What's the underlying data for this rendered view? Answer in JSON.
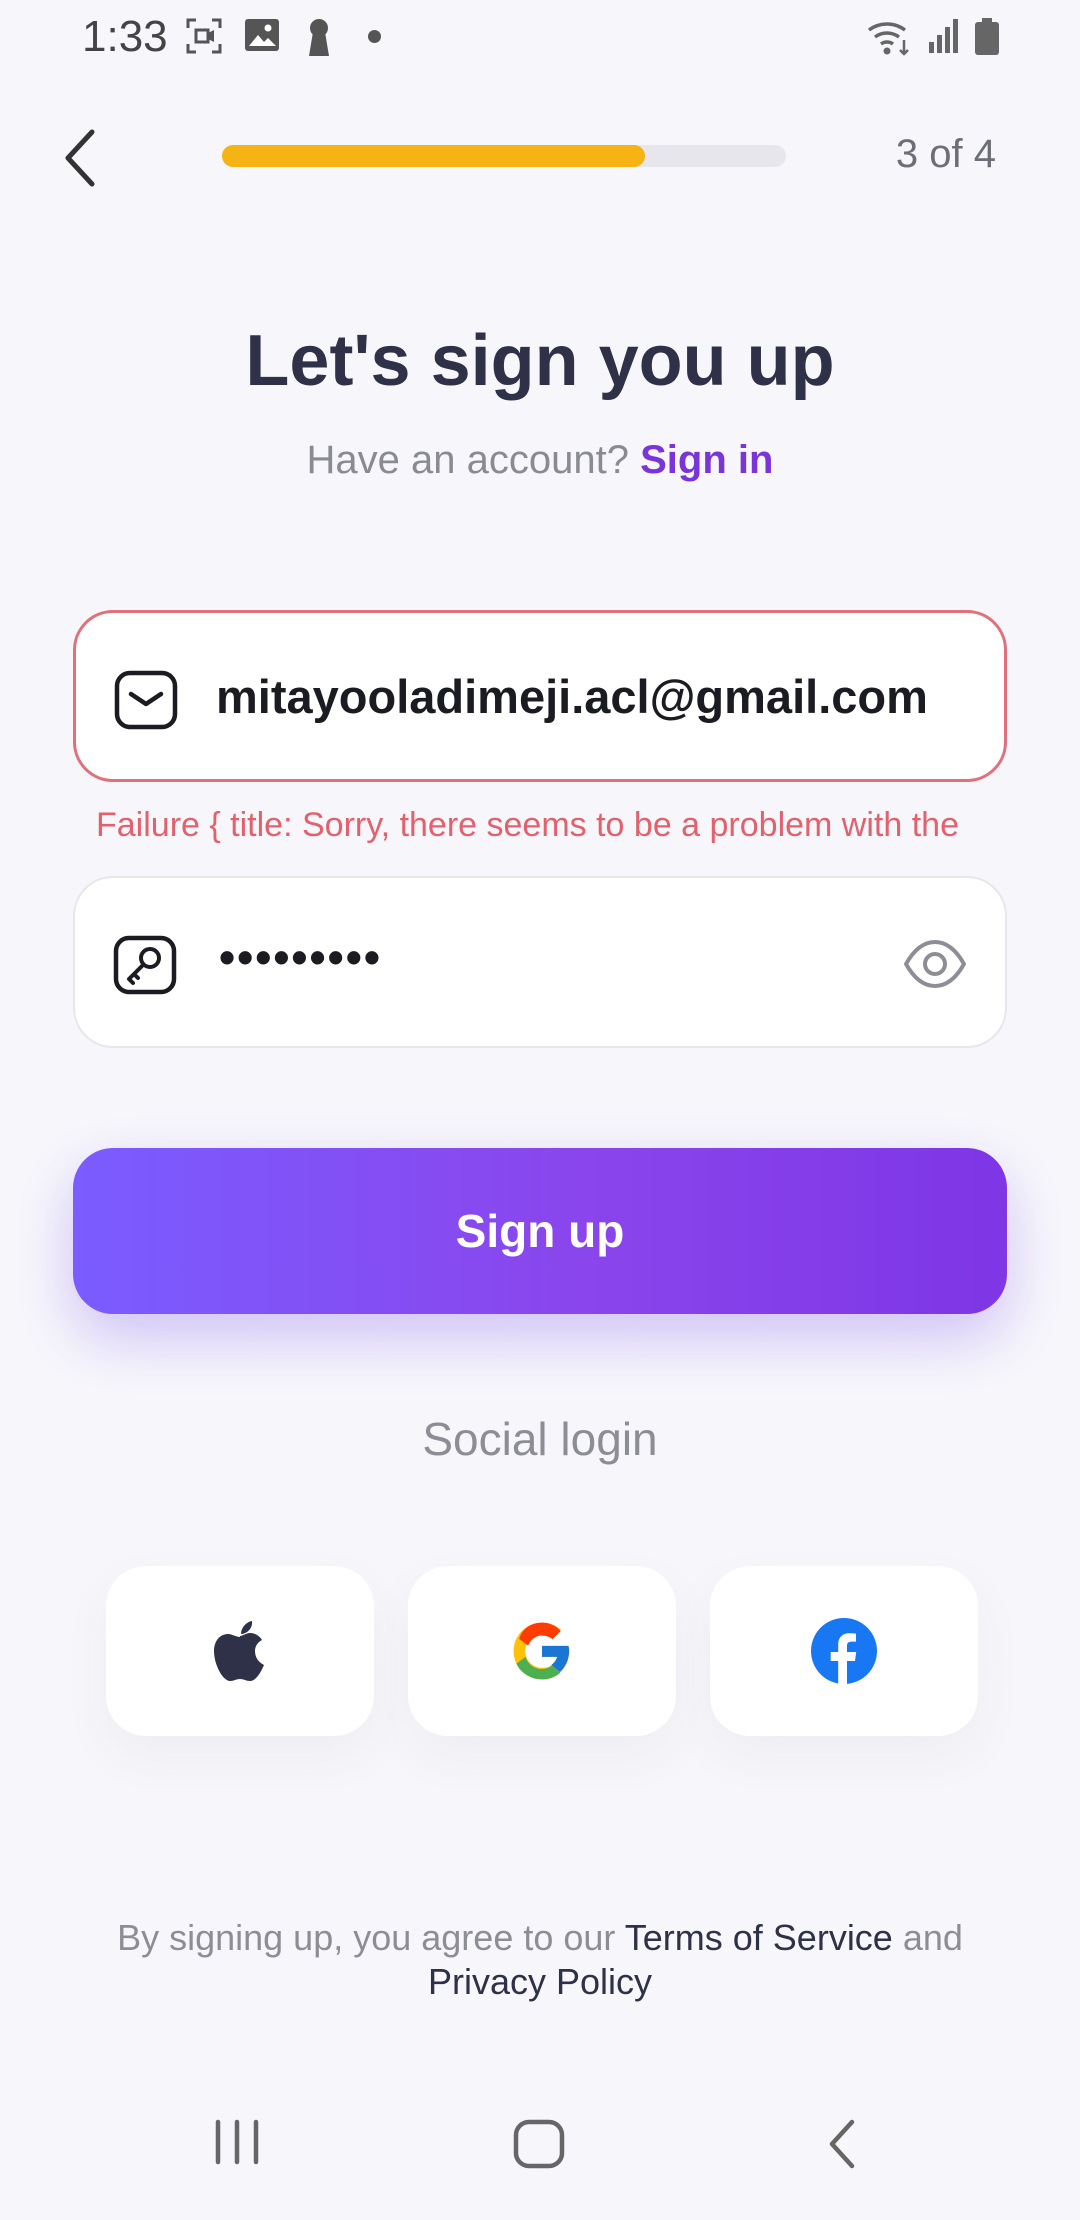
{
  "status_bar": {
    "time": "1:33",
    "left_icons": [
      "screen-record-icon",
      "gallery-icon",
      "keyhole-icon",
      "dot-icon"
    ],
    "right_icons": [
      "wifi-icon",
      "signal-icon",
      "battery-icon"
    ]
  },
  "header": {
    "back_icon": "chevron-left-icon",
    "progress_fraction": 0.75,
    "step_text": "3 of 4"
  },
  "title": "Let's sign you up",
  "subtitle": {
    "prompt": "Have an account? ",
    "link": "Sign in"
  },
  "email": {
    "icon": "mail-icon",
    "value": "mitayooladimeji.acl@gmail.com",
    "error": "Failure { title: Sorry, there seems to be a problem with the"
  },
  "password": {
    "icon": "key-icon",
    "value": "•••••••••",
    "toggle_icon": "eye-icon"
  },
  "signup_button": "Sign up",
  "social": {
    "label": "Social login",
    "buttons": [
      "apple-icon",
      "google-icon",
      "facebook-icon"
    ]
  },
  "terms": {
    "prefix": "By signing up, you agree to our ",
    "terms_link": "Terms of Service",
    "middle": " and",
    "privacy_link": "Privacy Policy"
  },
  "nav_bar": [
    "recent-apps-icon",
    "home-icon",
    "back-icon"
  ],
  "colors": {
    "accent": "#7a35d9",
    "progress": "#f5b413",
    "error": "#e2616c",
    "button_start": "#7a5cff",
    "button_end": "#7e36e6"
  }
}
